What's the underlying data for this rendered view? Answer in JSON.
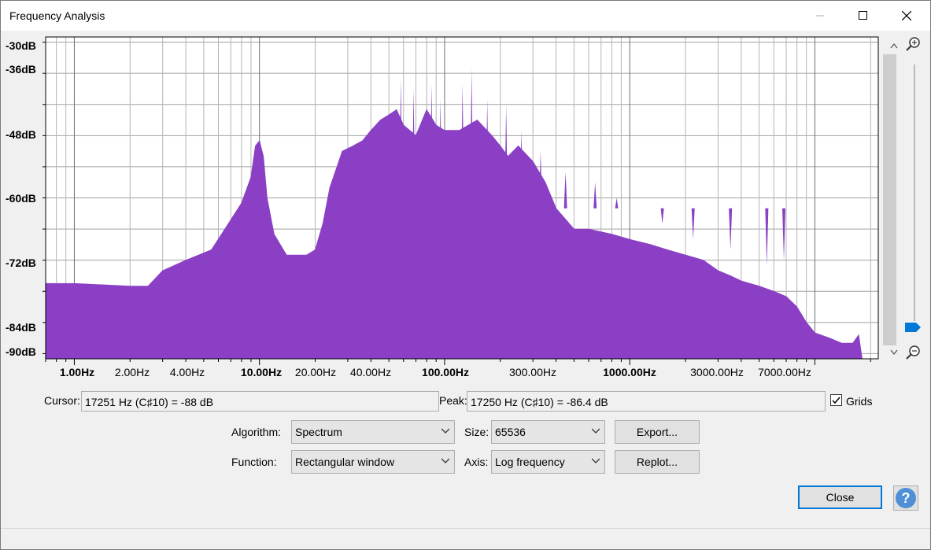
{
  "window": {
    "title": "Frequency Analysis"
  },
  "chart_data": {
    "type": "area",
    "title": "",
    "xlabel": "",
    "ylabel": "",
    "x_scale": "log",
    "xlim": [
      0.7,
      22000
    ],
    "ylim": [
      -91,
      -29
    ],
    "grid": true,
    "color": "#8a3fc4",
    "y_ticks": [
      "-30dB",
      "-36dB",
      "-48dB",
      "-60dB",
      "-72dB",
      "-84dB",
      "-90dB"
    ],
    "x_ticks": [
      {
        "label": "1.00Hz",
        "bold": true
      },
      {
        "label": "2.00Hz",
        "bold": false
      },
      {
        "label": "4.00Hz",
        "bold": false
      },
      {
        "label": "10.00Hz",
        "bold": true
      },
      {
        "label": "20.00Hz",
        "bold": false
      },
      {
        "label": "40.00Hz",
        "bold": false
      },
      {
        "label": "100.00Hz",
        "bold": true
      },
      {
        "label": "300.00Hz",
        "bold": false
      },
      {
        "label": "1000.00Hz",
        "bold": true
      },
      {
        "label": "3000.00Hz",
        "bold": false
      },
      {
        "label": "7000.00Hz",
        "bold": false
      }
    ],
    "x": [
      0.7,
      1,
      2,
      2.5,
      3,
      4,
      5.5,
      6.5,
      8,
      9,
      9.5,
      10,
      10.5,
      11,
      12,
      14,
      16,
      18,
      20,
      22,
      24,
      28,
      32,
      36,
      40,
      45,
      50,
      55,
      60,
      70,
      80,
      90,
      100,
      120,
      150,
      180,
      200,
      220,
      250,
      300,
      350,
      400,
      500,
      600,
      800,
      1000,
      1300,
      1600,
      2000,
      2500,
      3000,
      3500,
      4000,
      5000,
      6000,
      7000,
      8000,
      9000,
      10000,
      12000,
      14000,
      16000,
      17250,
      18000
    ],
    "y": [
      -76.5,
      -76.5,
      -77,
      -77,
      -74,
      -72,
      -70,
      -66,
      -61,
      -56,
      -50,
      -49,
      -52,
      -60,
      -67,
      -71,
      -71,
      -71,
      -70,
      -65,
      -58,
      -51,
      -50,
      -49,
      -47,
      -45,
      -44,
      -43,
      -46,
      -48,
      -43,
      -46,
      -47,
      -47,
      -45,
      -48,
      -50,
      -52,
      -50,
      -53,
      -57,
      -62,
      -66,
      -66,
      -67,
      -68,
      -69,
      -70,
      -71,
      -72,
      -74,
      -75,
      -76,
      -77,
      -78,
      -79,
      -81,
      -84,
      -86,
      -87,
      -88,
      -88,
      -86.4,
      -91
    ],
    "peaks": [
      {
        "x": 58,
        "y": -37
      },
      {
        "x": 68,
        "y": -39
      },
      {
        "x": 85,
        "y": -38
      },
      {
        "x": 95,
        "y": -41
      },
      {
        "x": 125,
        "y": -38
      },
      {
        "x": 140,
        "y": -35
      },
      {
        "x": 170,
        "y": -41
      },
      {
        "x": 215,
        "y": -42
      },
      {
        "x": 260,
        "y": -47
      },
      {
        "x": 330,
        "y": -51
      },
      {
        "x": 450,
        "y": -55
      },
      {
        "x": 650,
        "y": -57
      },
      {
        "x": 850,
        "y": -60
      },
      {
        "x": 1100,
        "y": -62
      },
      {
        "x": 1500,
        "y": -65
      },
      {
        "x": 2200,
        "y": -68
      },
      {
        "x": 3500,
        "y": -70
      },
      {
        "x": 5500,
        "y": -73
      },
      {
        "x": 6800,
        "y": -72
      }
    ]
  },
  "controls": {
    "cursor_label": "Cursor:",
    "cursor_value": "17251 Hz (C♯10) = -88 dB",
    "peak_label": "Peak:",
    "peak_value": "17250 Hz (C♯10) = -86.4 dB",
    "grids_label": "Grids",
    "grids_checked": true,
    "algorithm_label": "Algorithm:",
    "algorithm_value": "Spectrum",
    "size_label": "Size:",
    "size_value": "65536",
    "export_label": "Export...",
    "function_label": "Function:",
    "function_value": "Rectangular window",
    "axis_label": "Axis:",
    "axis_value": "Log frequency",
    "replot_label": "Replot...",
    "close_label": "Close",
    "help_label": "?"
  },
  "icons": {
    "zoom_in": "zoom-in-icon",
    "zoom_out": "zoom-out-icon",
    "slider_thumb": "slider-thumb-icon",
    "scroll_up": "scroll-up-arrow-icon",
    "scroll_down": "scroll-down-arrow-icon",
    "dropdown": "chevron-down-icon"
  }
}
